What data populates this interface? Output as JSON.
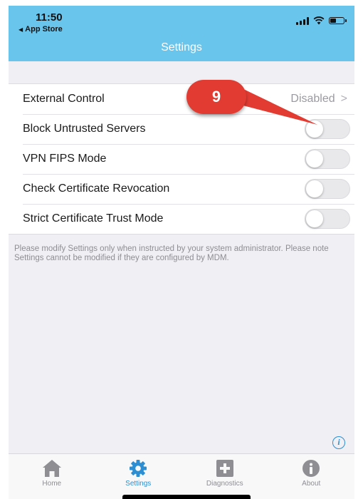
{
  "status_bar": {
    "time": "11:50",
    "back_label": "App Store",
    "back_arrow": "◀"
  },
  "nav": {
    "title": "Settings"
  },
  "settings": {
    "rows": [
      {
        "label": "External Control",
        "value": "Disabled",
        "chevron": ">"
      },
      {
        "label": "Block Untrusted Servers",
        "toggle_on": false
      },
      {
        "label": "VPN FIPS Mode",
        "toggle_on": false
      },
      {
        "label": "Check Certificate Revocation",
        "toggle_on": false
      },
      {
        "label": "Strict Certificate Trust Mode",
        "toggle_on": false
      }
    ]
  },
  "note": "Please modify Settings only when instructed by your system administrator. Please note Settings cannot be modified if they are configured by MDM.",
  "info_glyph": "i",
  "annotation": {
    "number": "9",
    "color": "#e23b32"
  },
  "tabbar": {
    "active": "Settings",
    "active_color": "#2d8fd1",
    "tabs": [
      {
        "label": "Home",
        "icon": "home-icon"
      },
      {
        "label": "Settings",
        "icon": "gear-icon"
      },
      {
        "label": "Diagnostics",
        "icon": "plus-box-icon"
      },
      {
        "label": "About",
        "icon": "info-circle-icon"
      }
    ]
  }
}
